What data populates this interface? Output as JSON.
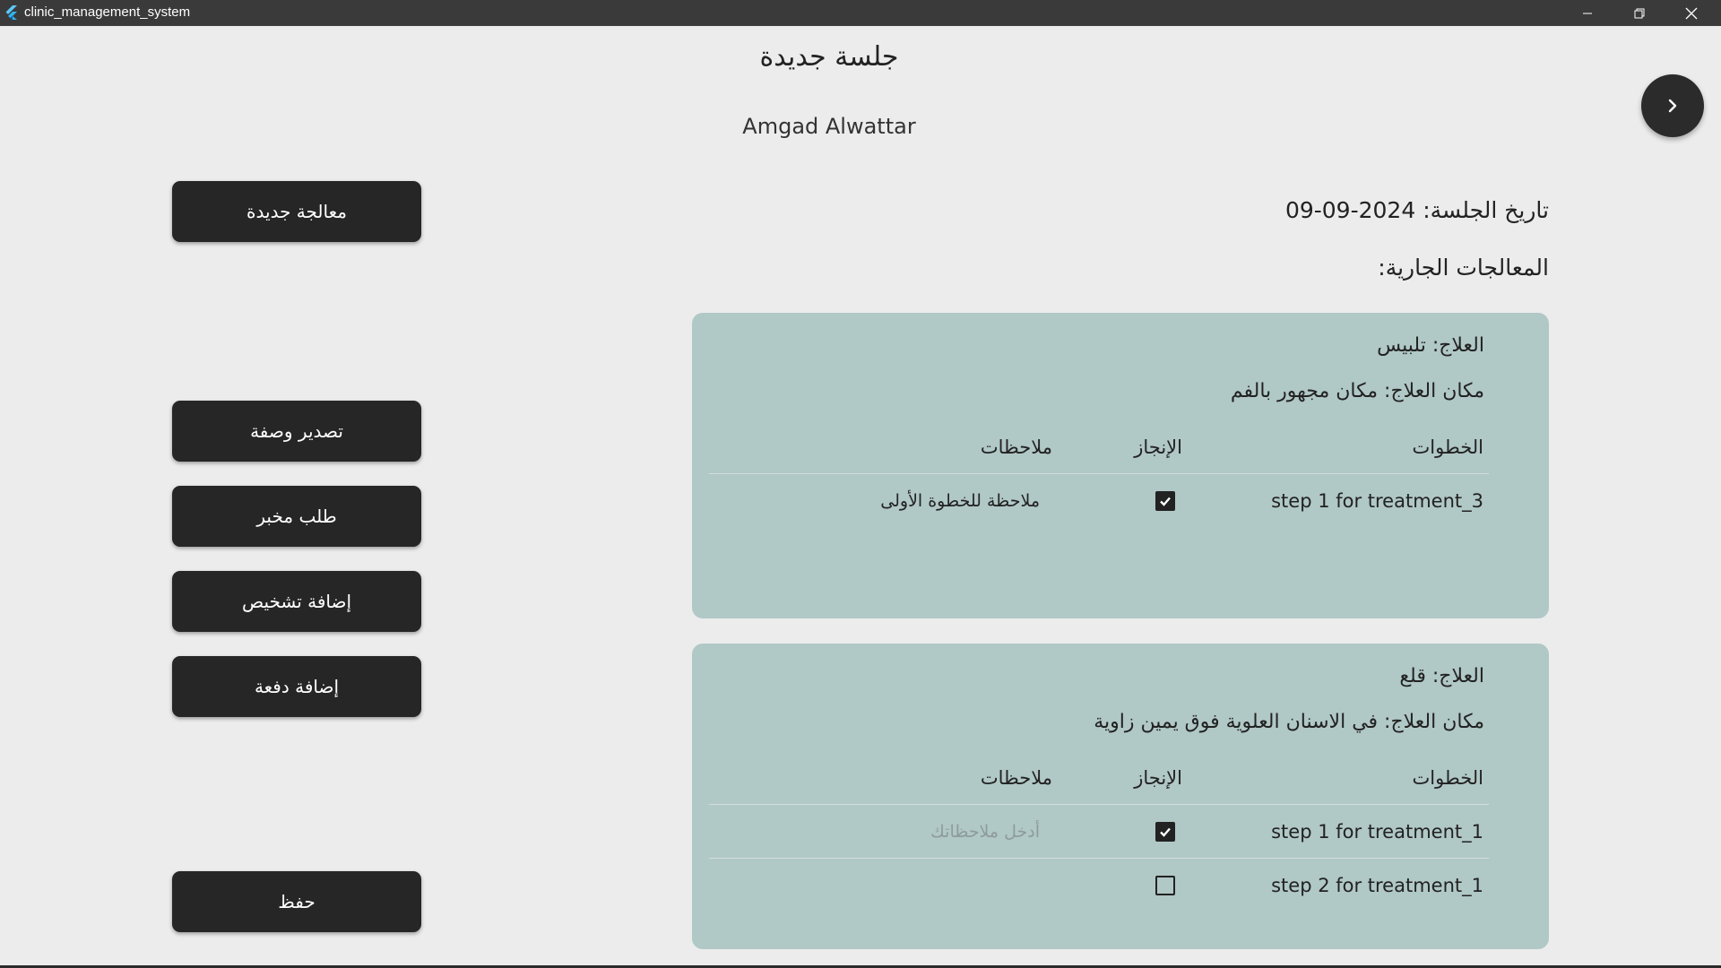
{
  "window": {
    "title": "clinic_management_system"
  },
  "header": {
    "title": "جلسة جديدة",
    "patient_name": "Amgad Alwattar"
  },
  "sidebar": {
    "new_treatment": "معالجة جديدة",
    "export_prescription": "تصدير وصفة",
    "lab_request": "طلب مخبر",
    "add_diagnosis": "إضافة تشخيص",
    "add_payment": "إضافة دفعة",
    "save": "حفظ"
  },
  "session": {
    "date_text": "تاريخ الجلسة: 2024-09-09",
    "ongoing_label": "المعالجات الجارية:"
  },
  "table_headers": {
    "steps": "الخطوات",
    "done": "الإنجاز",
    "notes": "ملاحظات"
  },
  "notes_placeholder": "أدخل ملاحظاتك",
  "treatments": [
    {
      "treatment": "العلاج: تلبيس",
      "location": "مكان العلاج: مكان مجهور  بالفم",
      "steps": [
        {
          "name": "step 1 for treatment_3",
          "done": true,
          "note": "ملاحظة للخطوة الأولى"
        }
      ]
    },
    {
      "treatment": "العلاج: قلع",
      "location": "مكان العلاج: في الاسنان العلوية فوق يمين زاوية",
      "steps": [
        {
          "name": "step 1 for treatment_1",
          "done": true,
          "note": ""
        },
        {
          "name": "step 2 for treatment_1",
          "done": false,
          "note": ""
        }
      ]
    }
  ],
  "icons": {
    "app": "flutter-logo-icon",
    "next": "chevron-right-icon",
    "check": "check-icon"
  },
  "colors": {
    "button_bg": "#262626",
    "card_bg": "#b0c8c6",
    "page_bg": "#ececec",
    "titlebar_bg": "#3a3a3a"
  }
}
